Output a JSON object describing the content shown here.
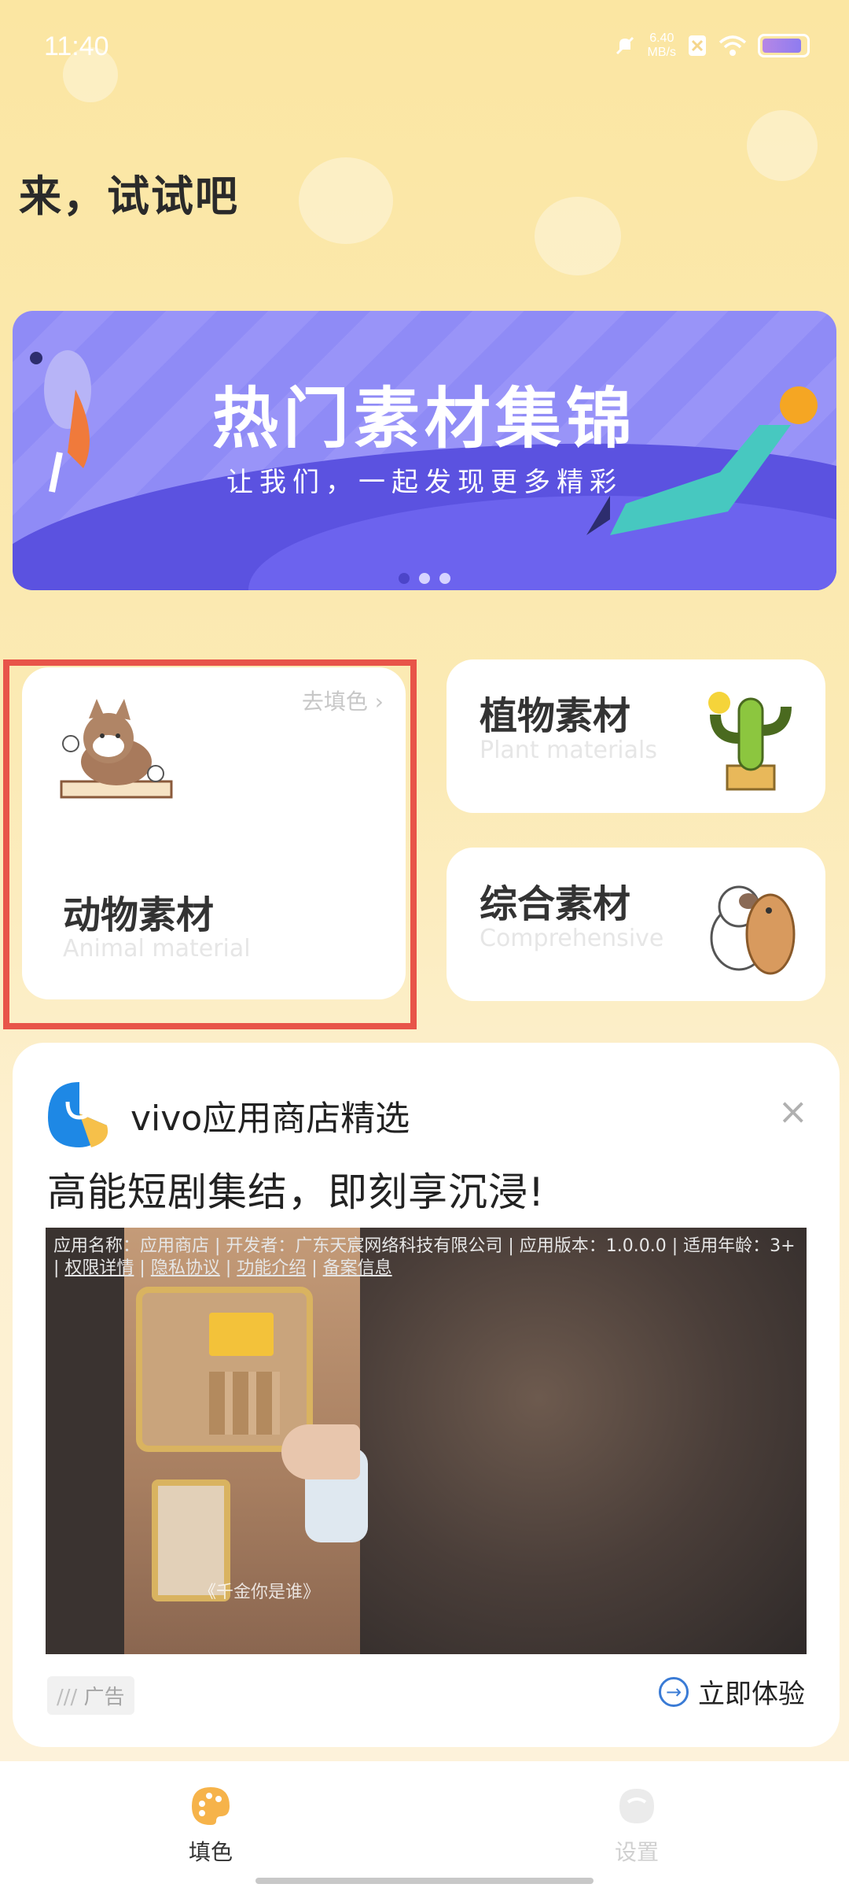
{
  "status_bar": {
    "time": "11:40",
    "speed_value": "6.40",
    "speed_unit": "MB/s"
  },
  "page": {
    "title": "来，试试吧"
  },
  "banner": {
    "title": "热门素材集锦",
    "subtitle": "让我们，一起发现更多精彩",
    "dots_total": 3,
    "active_dot": 1
  },
  "categories": {
    "animal": {
      "title": "动物素材",
      "subtitle": "Animal material",
      "action": "去填色 ›"
    },
    "plant": {
      "title": "植物素材",
      "subtitle": "Plant materials"
    },
    "comprehensive": {
      "title": "综合素材",
      "subtitle": "Comprehensive"
    }
  },
  "ad": {
    "source": "vivo应用商店精选",
    "close": "×",
    "headline": "高能短剧集结，即刻享沉浸!",
    "info_line": "应用名称：应用商店 | 开发者：广东天宸网络科技有限公司 | 应用版本：1.0.0.0 | 适用年龄：3+",
    "info_links": [
      "权限详情",
      "隐私协议",
      "功能介绍",
      "备案信息"
    ],
    "drama_title": "《千金你是谁》",
    "tag": "广告",
    "cta": "立即体验"
  },
  "bottom_nav": {
    "items": [
      {
        "label": "填色",
        "active": true
      },
      {
        "label": "设置",
        "active": false
      }
    ]
  },
  "colors": {
    "banner_purple": "#8f8bf6",
    "highlight_red": "#e85449",
    "cta_blue": "#3a7bd5",
    "nav_active_orange": "#f6b34a"
  }
}
